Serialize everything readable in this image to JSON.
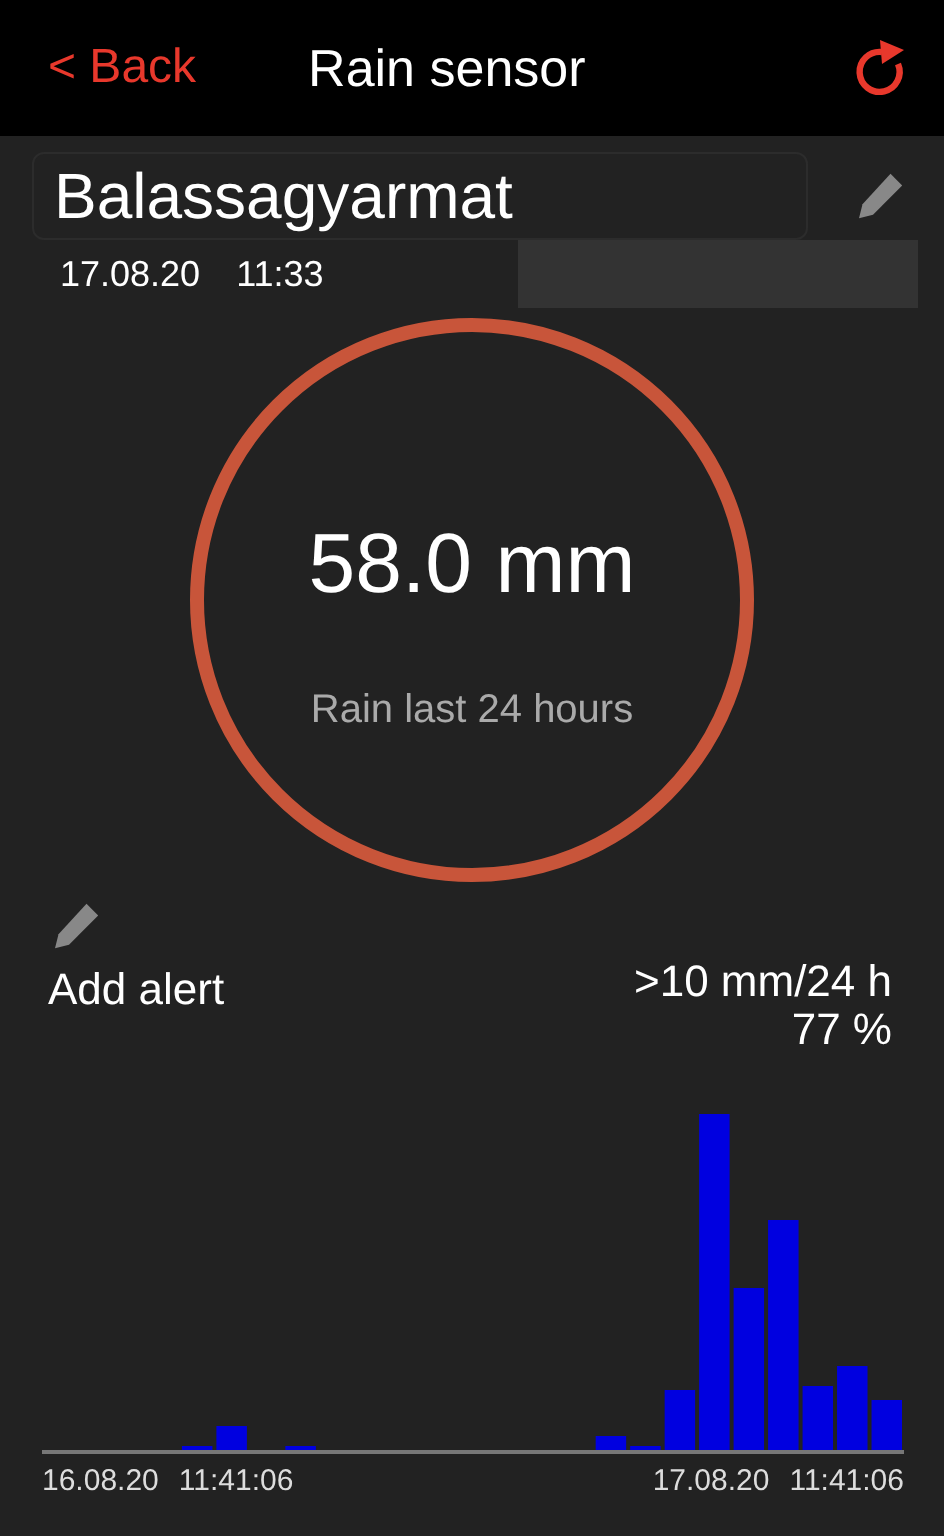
{
  "header": {
    "back": "< Back",
    "title": "Rain sensor"
  },
  "station": {
    "name": "Balassagyarmat",
    "date": "17.08.20",
    "time": "11:33"
  },
  "gauge": {
    "value": "58.0 mm",
    "caption": "Rain last 24 hours"
  },
  "alert": {
    "label": "Add alert",
    "threshold": ">10 mm/24 h",
    "probability": "77 %"
  },
  "chart": {
    "start_date": "16.08.20",
    "start_time": "11:41:06",
    "end_date": "17.08.20",
    "end_time": "11:41:06"
  }
}
